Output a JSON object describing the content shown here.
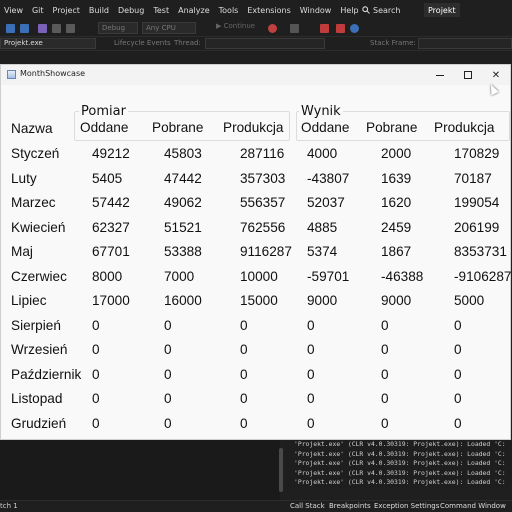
{
  "ide": {
    "menu": [
      "View",
      "Git",
      "Project",
      "Build",
      "Debug",
      "Test",
      "Analyze",
      "Tools",
      "Extensions",
      "Window",
      "Help"
    ],
    "search_label": "Search",
    "project_badge": "Projekt",
    "toolbar": {
      "config_value": "Debug",
      "platform_value": "Any CPU",
      "continue_label": "Continue"
    },
    "debugbar": {
      "process_value": "Projekt.exe",
      "lifecycle_label": "Lifecycle Events",
      "thread_label": "Thread:",
      "stackframe_label": "Stack Frame:"
    },
    "output_lines": [
      "'Projekt.exe' (CLR v4.0.30319: Projekt.exe): Loaded 'C:",
      "'Projekt.exe' (CLR v4.0.30319: Projekt.exe): Loaded 'C:",
      "'Projekt.exe' (CLR v4.0.30319: Projekt.exe): Loaded 'C:",
      "'Projekt.exe' (CLR v4.0.30319: Projekt.exe): Loaded 'C:",
      "'Projekt.exe' (CLR v4.0.30319: Projekt.exe): Loaded 'C:"
    ],
    "status": {
      "left": "tch 1",
      "tabs": [
        "Call Stack",
        "Breakpoints",
        "Exception Settings",
        "Command Window"
      ]
    }
  },
  "form": {
    "title": "MonthShowcase",
    "min_glyph": "",
    "close_glyph": "✕",
    "group_pomiar": "Pomiar",
    "group_wynik": "Wynik",
    "headers": {
      "nazwa": "Nazwa",
      "p_oddane": "Oddane",
      "p_pobrane": "Pobrane",
      "p_produkcja": "Produkcja",
      "w_oddane": "Oddane",
      "w_pobrane": "Pobrane",
      "w_produkcja": "Produkcja"
    },
    "rows": [
      [
        "Styczeń",
        "49212",
        "45803",
        "287116",
        "4000",
        "2000",
        "170829"
      ],
      [
        "Luty",
        "5405",
        "47442",
        "357303",
        "-43807",
        "1639",
        "70187"
      ],
      [
        "Marzec",
        "57442",
        "49062",
        "556357",
        "52037",
        "1620",
        "199054"
      ],
      [
        "Kwiecień",
        "62327",
        "51521",
        "762556",
        "4885",
        "2459",
        "206199"
      ],
      [
        "Maj",
        "67701",
        "53388",
        "9116287",
        "5374",
        "1867",
        "8353731"
      ],
      [
        "Czerwiec",
        "8000",
        "7000",
        "10000",
        "-59701",
        "-46388",
        "-9106287"
      ],
      [
        "Lipiec",
        "17000",
        "16000",
        "15000",
        "9000",
        "9000",
        "5000"
      ],
      [
        "Sierpień",
        "0",
        "0",
        "0",
        "0",
        "0",
        "0"
      ],
      [
        "Wrzesień",
        "0",
        "0",
        "0",
        "0",
        "0",
        "0"
      ],
      [
        "Październik",
        "0",
        "0",
        "0",
        "0",
        "0",
        "0"
      ],
      [
        "Listopad",
        "0",
        "0",
        "0",
        "0",
        "0",
        "0"
      ],
      [
        "Grudzień",
        "0",
        "0",
        "0",
        "0",
        "0",
        "0"
      ]
    ]
  }
}
